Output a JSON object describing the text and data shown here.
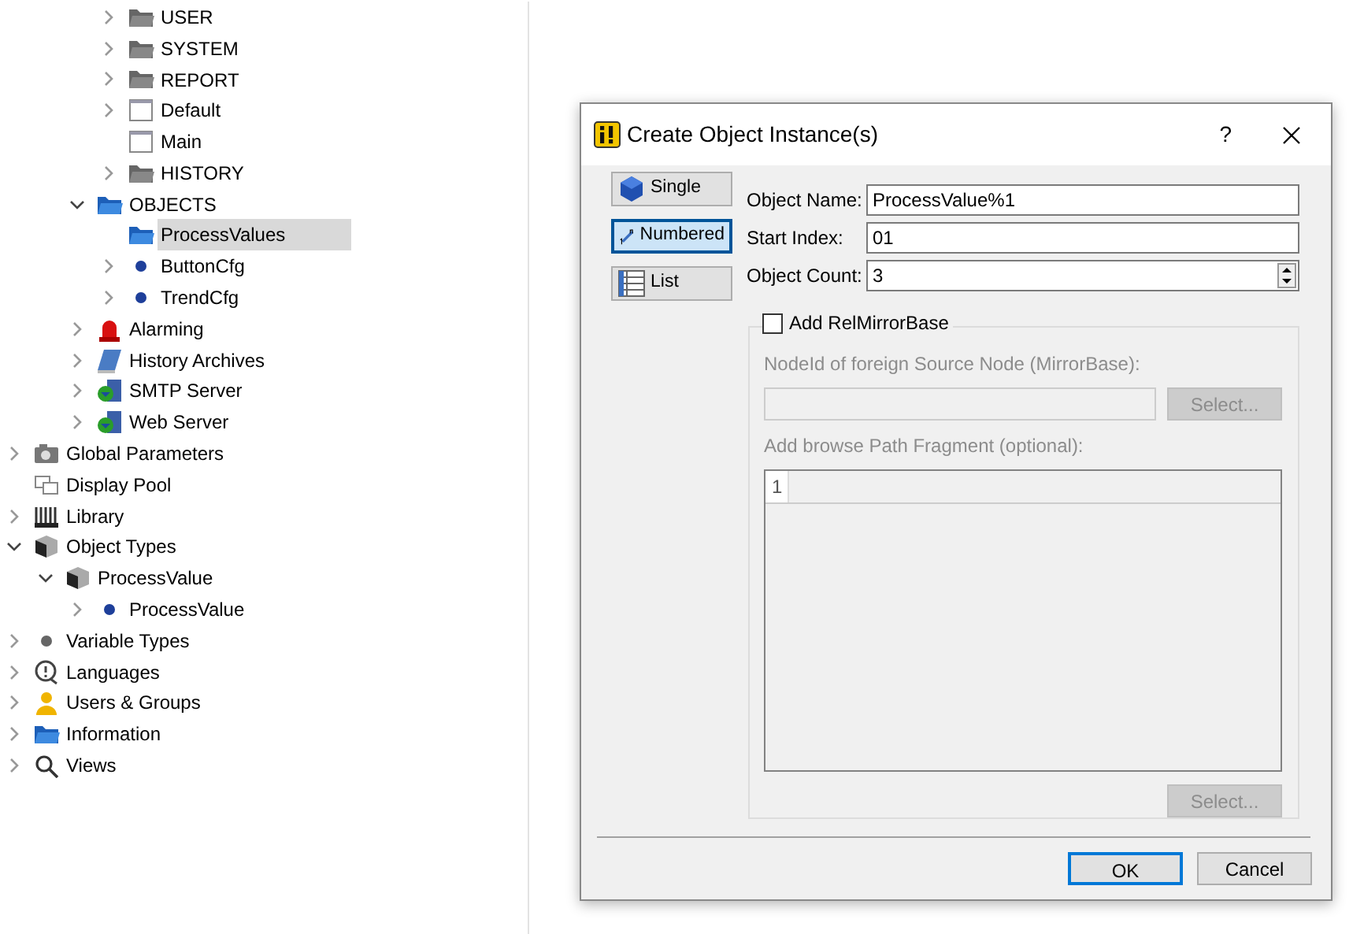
{
  "tree": {
    "hidden_parent_children": [
      {
        "label": "USER",
        "kind": "folder-grey",
        "expanded": false,
        "selected": false
      },
      {
        "label": "SYSTEM",
        "kind": "folder-grey",
        "expanded": false,
        "selected": false
      },
      {
        "label": "REPORT",
        "kind": "folder-grey",
        "expanded": false,
        "selected": false
      },
      {
        "label": "Default",
        "kind": "window",
        "expanded": false,
        "selected": false
      },
      {
        "label": "Main",
        "kind": "window",
        "selected": false
      },
      {
        "label": "HISTORY",
        "kind": "folder-grey",
        "expanded": false,
        "selected": false
      }
    ],
    "cut_branch": [
      {
        "label": "OBJECTS",
        "kind": "folder-blue",
        "expanded": true,
        "selected": false,
        "children": [
          {
            "label": "ProcessValues",
            "kind": "folder-blue",
            "selected": true
          },
          {
            "label": "ButtonCfg",
            "kind": "dot-blue",
            "expanded": false,
            "selected": false
          },
          {
            "label": "TrendCfg",
            "kind": "dot-blue",
            "expanded": false,
            "selected": false
          }
        ]
      },
      {
        "label": "Alarming",
        "kind": "alarm",
        "expanded": false,
        "selected": false
      },
      {
        "label": "History Archives",
        "kind": "book",
        "expanded": false,
        "selected": false
      },
      {
        "label": "SMTP Server",
        "kind": "server",
        "expanded": false,
        "selected": false
      },
      {
        "label": "Web Server",
        "kind": "server",
        "expanded": false,
        "selected": false
      }
    ],
    "nodes": [
      {
        "label": "Global Parameters",
        "kind": "camera",
        "expanded": false,
        "selected": false
      },
      {
        "label": "Display Pool",
        "kind": "pool",
        "selected": false
      },
      {
        "label": "Library",
        "kind": "library",
        "expanded": false,
        "selected": false
      },
      {
        "label": "Object Types",
        "kind": "cube",
        "expanded": true,
        "selected": false,
        "children": [
          {
            "label": "ProcessValue",
            "kind": "cube",
            "expanded": true,
            "selected": false,
            "children": [
              {
                "label": "ProcessValue",
                "kind": "dot-blue",
                "expanded": false,
                "selected": false
              }
            ]
          }
        ]
      },
      {
        "label": "Variable Types",
        "kind": "dot-grey",
        "expanded": false,
        "selected": false
      },
      {
        "label": "Languages",
        "kind": "languages",
        "expanded": false,
        "selected": false
      },
      {
        "label": "Users & Groups",
        "kind": "user",
        "expanded": false,
        "selected": false
      },
      {
        "label": "Information",
        "kind": "folder-blue",
        "expanded": false,
        "selected": false
      },
      {
        "label": "Views",
        "kind": "search",
        "expanded": false,
        "selected": false
      }
    ]
  },
  "dialog": {
    "title": "Create Object Instance(s)",
    "help": "?",
    "modes": [
      {
        "label": "Single",
        "kind": "single",
        "selected": false
      },
      {
        "label": "Numbered",
        "kind": "numbered",
        "selected": true
      },
      {
        "label": "List",
        "kind": "list",
        "selected": false
      }
    ],
    "fields": [
      {
        "label": "Object Name:",
        "value": "ProcessValue%1",
        "kind": "text"
      },
      {
        "label": "Start Index:",
        "value": "01",
        "kind": "text"
      },
      {
        "label": "Object Count:",
        "value": "3",
        "kind": "spin"
      }
    ],
    "mirror": {
      "label": "Add RelMirrorBase",
      "checked": false,
      "disabled": true,
      "node_label": "NodeId of foreign Source Node (MirrorBase):",
      "select1": "Select...",
      "path_label": "Add browse Path Fragment (optional):",
      "line_number": "1",
      "select2": "Select..."
    },
    "ok": "OK",
    "cancel": "Cancel"
  }
}
